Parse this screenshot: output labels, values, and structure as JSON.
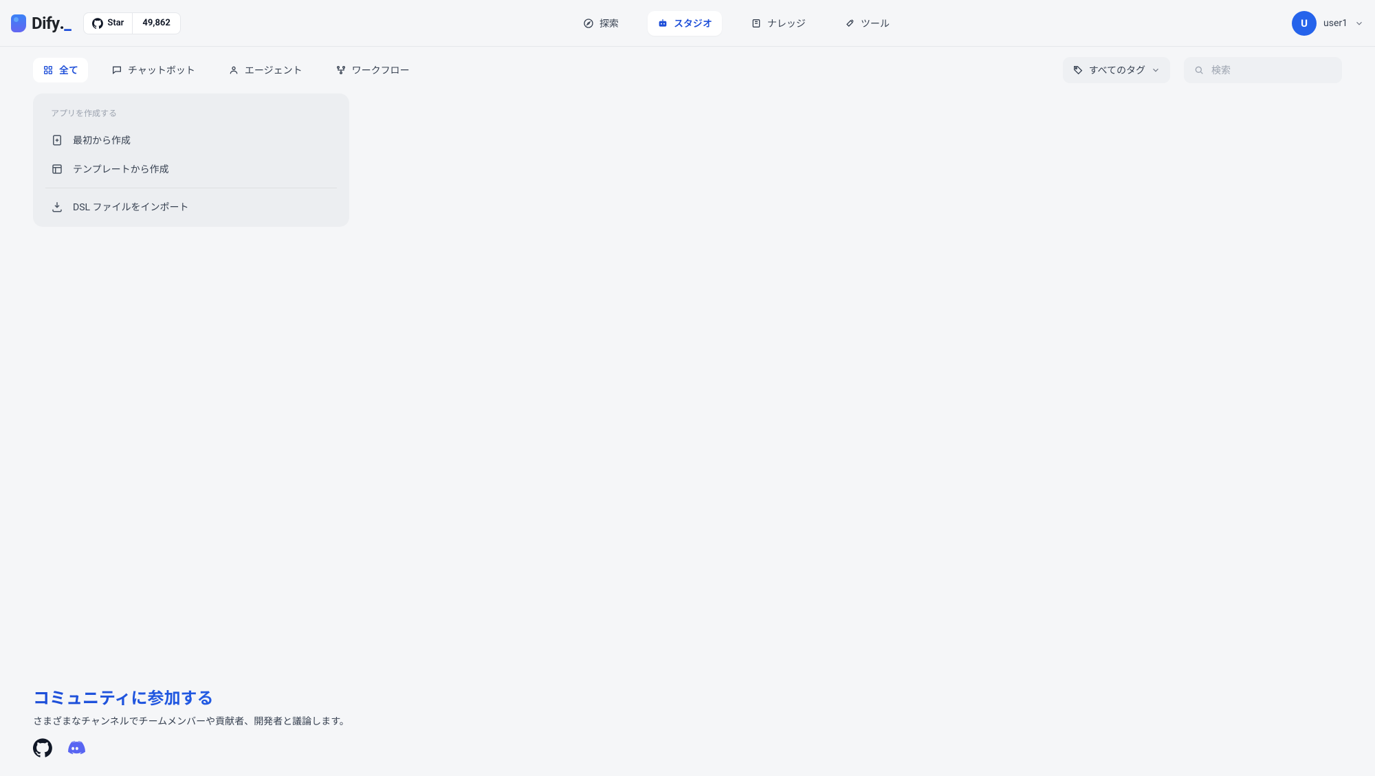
{
  "colors": {
    "primary": "#1d4ed8",
    "bg": "#f5f6f8",
    "panel": "#eceef1",
    "muted": "#6b7280",
    "text": "#1f2328"
  },
  "header": {
    "logo_text": "Dify",
    "github": {
      "star_label": "Star",
      "star_count": "49,862"
    },
    "nav": [
      {
        "key": "explore",
        "label": "探索",
        "active": false,
        "icon": "compass-icon"
      },
      {
        "key": "studio",
        "label": "スタジオ",
        "active": true,
        "icon": "robot-icon"
      },
      {
        "key": "knowledge",
        "label": "ナレッジ",
        "active": false,
        "icon": "book-icon"
      },
      {
        "key": "tools",
        "label": "ツール",
        "active": false,
        "icon": "hammer-icon"
      }
    ],
    "user": {
      "name": "user1",
      "avatar_initial": "U"
    }
  },
  "filters": {
    "tabs": [
      {
        "key": "all",
        "label": "全て",
        "active": true,
        "icon": "grid-icon"
      },
      {
        "key": "chatbot",
        "label": "チャットボット",
        "active": false,
        "icon": "chat-icon"
      },
      {
        "key": "agent",
        "label": "エージェント",
        "active": false,
        "icon": "agent-icon"
      },
      {
        "key": "workflow",
        "label": "ワークフロー",
        "active": false,
        "icon": "workflow-icon"
      }
    ],
    "tag_dropdown": {
      "label": "すべてのタグ"
    },
    "search": {
      "placeholder": "検索",
      "value": ""
    }
  },
  "create_card": {
    "title": "アプリを作成する",
    "rows": [
      {
        "key": "blank",
        "label": "最初から作成",
        "icon": "file-plus-icon"
      },
      {
        "key": "template",
        "label": "テンプレートから作成",
        "icon": "template-icon"
      },
      {
        "key": "import",
        "label": "DSL ファイルをインポート",
        "icon": "import-icon",
        "divider_before": true
      }
    ]
  },
  "community": {
    "heading": "コミュニティに参加する",
    "subtext": "さまざまなチャンネルでチームメンバーや貢献者、開発者と議論します。",
    "links": [
      {
        "key": "github",
        "icon": "github-icon"
      },
      {
        "key": "discord",
        "icon": "discord-icon"
      }
    ]
  }
}
